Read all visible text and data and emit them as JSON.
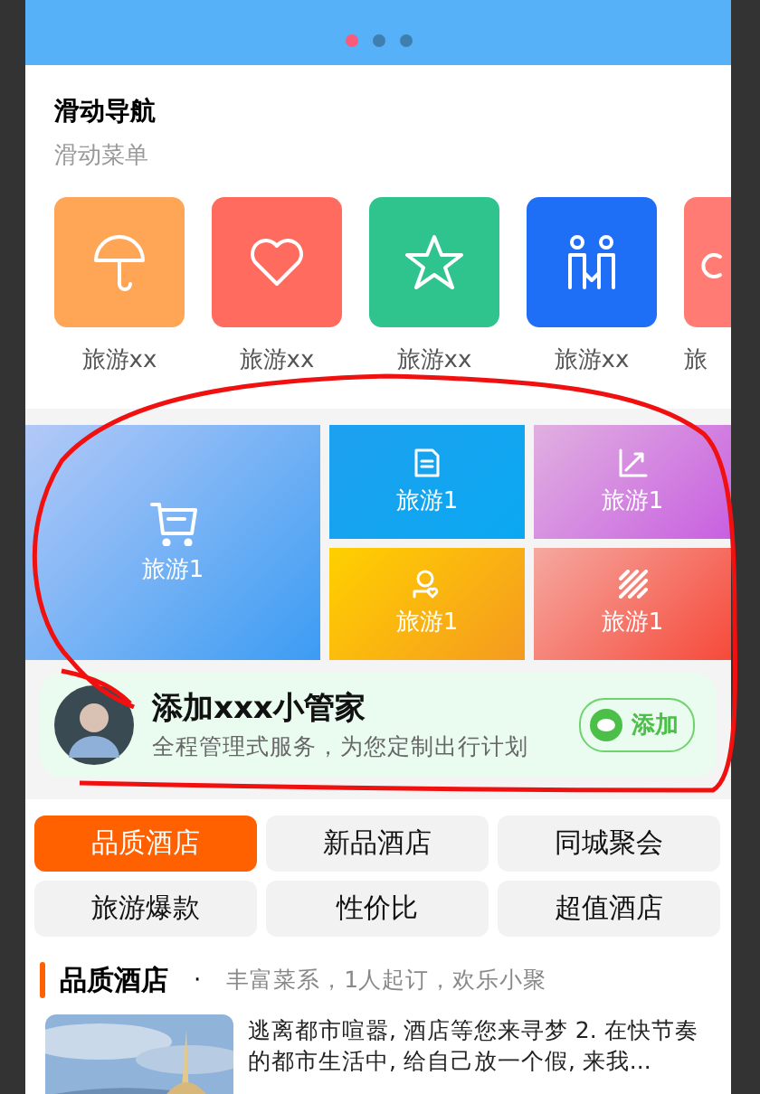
{
  "banner": {
    "dots": [
      {
        "selected": true
      },
      {
        "selected": false
      },
      {
        "selected": false
      }
    ]
  },
  "nav": {
    "title": "滑动导航",
    "subtitle": "滑动菜单",
    "items": [
      {
        "label": "旅游xx",
        "kind": "umbrella",
        "color": "#ffa556"
      },
      {
        "label": "旅游xx",
        "kind": "heart",
        "color": "#ff6b5e"
      },
      {
        "label": "旅游xx",
        "kind": "star",
        "color": "#2fc48d"
      },
      {
        "label": "旅游xx",
        "kind": "people",
        "color": "#1e6ef6"
      },
      {
        "label": "旅",
        "kind": "note",
        "color": "#ff7b73"
      }
    ]
  },
  "tiles": [
    {
      "label": "旅游1",
      "kind": "cart"
    },
    {
      "label": "旅游1",
      "kind": "doc"
    },
    {
      "label": "旅游1",
      "kind": "chart"
    },
    {
      "label": "旅游1",
      "kind": "user"
    },
    {
      "label": "旅游1",
      "kind": "stripes"
    }
  ],
  "assistant": {
    "title": "添加xxx小管家",
    "subtitle": "全程管理式服务，为您定制出行计划",
    "button": "添加"
  },
  "tabs": [
    {
      "label": "品质酒店",
      "selected": true
    },
    {
      "label": "新品酒店",
      "selected": false
    },
    {
      "label": "同城聚会",
      "selected": false
    },
    {
      "label": "旅游爆款",
      "selected": false
    },
    {
      "label": "性价比",
      "selected": false
    },
    {
      "label": "超值酒店",
      "selected": false
    }
  ],
  "section": {
    "title": "品质酒店",
    "separator": "·",
    "subtitle": "丰富菜系，1人起订，欢乐小聚"
  },
  "products": [
    {
      "description": "逃离都市喧嚣, 酒店等您来寻梦 2. 在快节奏的都市生活中, 给自己放一个假, 来我..."
    }
  ]
}
